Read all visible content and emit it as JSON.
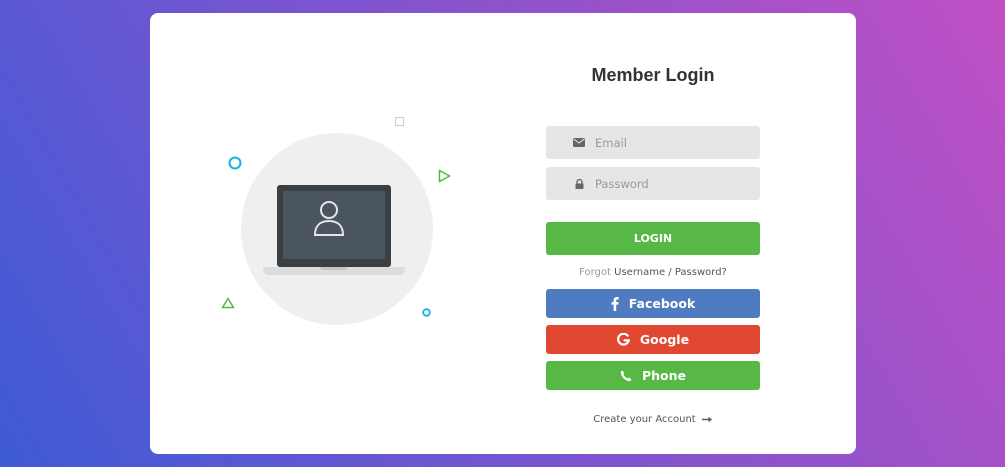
{
  "form": {
    "title": "Member Login",
    "email_placeholder": "Email",
    "password_placeholder": "Password",
    "login_label": "LOGIN",
    "forgot_prefix": "Forgot",
    "forgot_link": "Username / Password?",
    "facebook_label": "Facebook",
    "google_label": "Google",
    "phone_label": "Phone",
    "create_label": "Create your Account"
  },
  "icons": {
    "email": "envelope-icon",
    "password": "lock-icon",
    "facebook": "facebook-icon",
    "google": "google-icon",
    "phone": "phone-icon",
    "arrow": "arrow-right-icon",
    "illustration": "laptop-user-icon"
  },
  "colors": {
    "background_start": "#3e5bd6",
    "background_end": "#c04fc4",
    "login": "#57b846",
    "facebook": "#4f7cc1",
    "google": "#e14832",
    "phone": "#57b846"
  }
}
